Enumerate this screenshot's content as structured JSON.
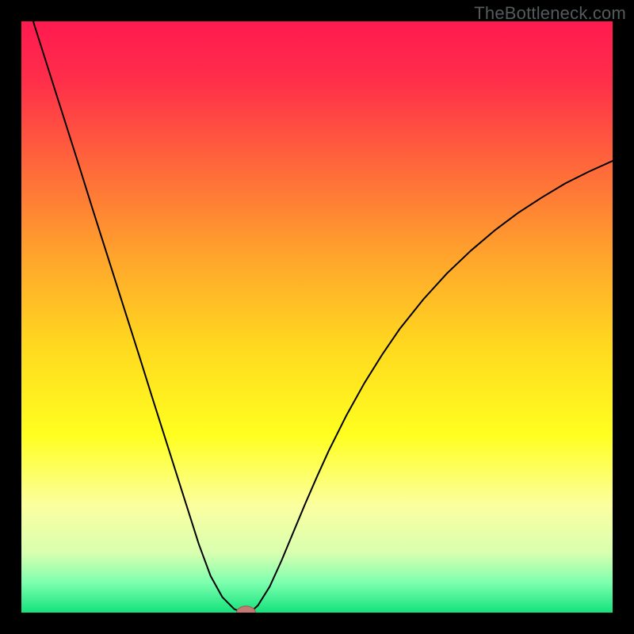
{
  "watermark": "TheBottleneck.com",
  "colors": {
    "frame": "#000000",
    "gradient_stops": [
      {
        "offset": 0.0,
        "color": "#ff1a50"
      },
      {
        "offset": 0.1,
        "color": "#ff2e4a"
      },
      {
        "offset": 0.25,
        "color": "#ff6a3a"
      },
      {
        "offset": 0.4,
        "color": "#ffa52c"
      },
      {
        "offset": 0.55,
        "color": "#ffd91f"
      },
      {
        "offset": 0.7,
        "color": "#ffff20"
      },
      {
        "offset": 0.82,
        "color": "#fbffa0"
      },
      {
        "offset": 0.9,
        "color": "#d8ffb0"
      },
      {
        "offset": 0.95,
        "color": "#7bffae"
      },
      {
        "offset": 1.0,
        "color": "#14e27b"
      }
    ],
    "curve": "#000000",
    "marker_fill": "#c37a71",
    "marker_stroke": "#9c5f59"
  },
  "chart_data": {
    "type": "line",
    "title": "",
    "xlabel": "",
    "ylabel": "",
    "xlim": [
      0,
      100
    ],
    "ylim": [
      0,
      100
    ],
    "x": [
      2,
      4,
      6,
      8,
      10,
      12,
      14,
      16,
      18,
      20,
      22,
      24,
      26,
      28,
      30,
      32,
      34,
      36,
      37,
      38,
      39,
      40,
      42,
      44,
      46,
      48,
      50,
      52,
      55,
      58,
      61,
      64,
      68,
      72,
      76,
      80,
      84,
      88,
      92,
      96,
      100
    ],
    "values": [
      100,
      93.7,
      87.4,
      81.1,
      74.8,
      68.4,
      62.1,
      55.8,
      49.5,
      43.2,
      36.8,
      30.5,
      24.2,
      17.9,
      11.6,
      6.2,
      2.6,
      0.6,
      0.2,
      0.0,
      0.3,
      1.2,
      4.4,
      8.8,
      13.6,
      18.4,
      23.0,
      27.4,
      33.4,
      38.8,
      43.6,
      48.0,
      53.0,
      57.4,
      61.2,
      64.6,
      67.6,
      70.2,
      72.6,
      74.6,
      76.4
    ],
    "marker": {
      "x": 38.0,
      "y": 0.0,
      "rx": 1.6,
      "ry": 1.1
    }
  }
}
